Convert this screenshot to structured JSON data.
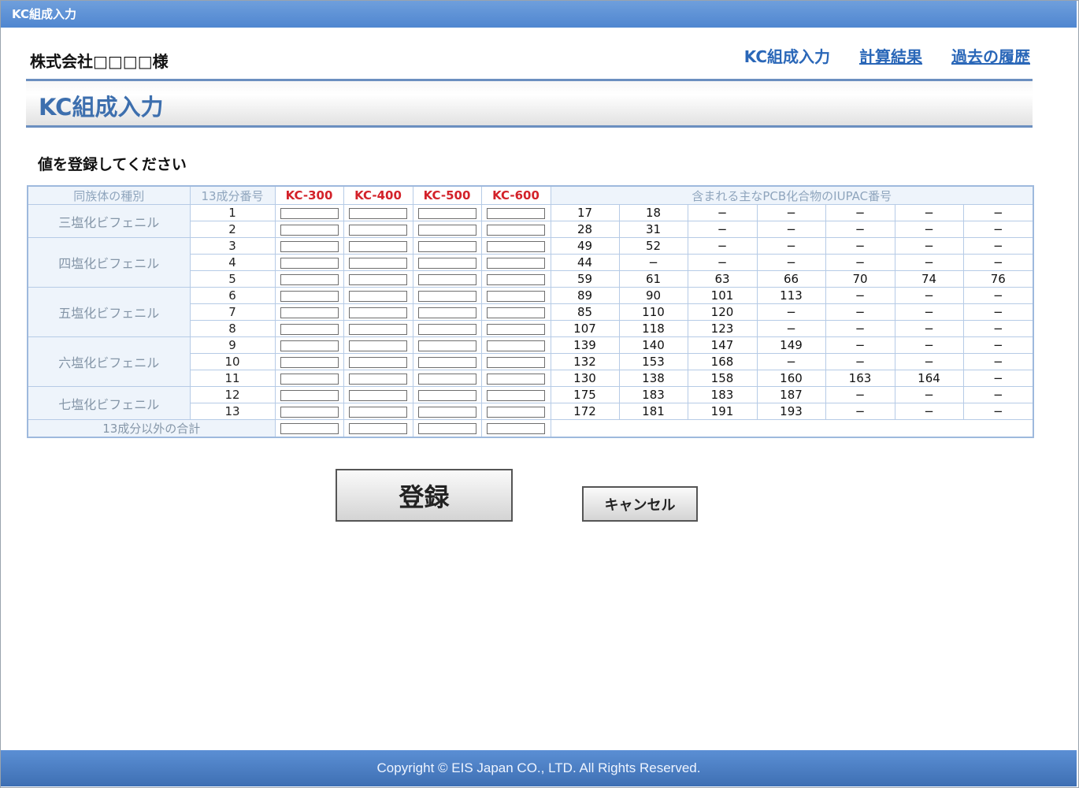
{
  "window": {
    "title": "KC組成入力"
  },
  "header": {
    "company": "株式会社□□□□様",
    "nav": [
      {
        "label": "KC組成入力",
        "link": false
      },
      {
        "label": "計算結果",
        "link": true
      },
      {
        "label": "過去の履歴",
        "link": true
      }
    ]
  },
  "page": {
    "heading": "KC組成入力",
    "instruction": "値を登録してください"
  },
  "table": {
    "headers": {
      "group": "同族体の種別",
      "number": "13成分番号",
      "kc": [
        "KC-300",
        "KC-400",
        "KC-500",
        "KC-600"
      ],
      "iupac": "含まれる主なPCB化合物のIUPAC番号"
    },
    "groups": [
      {
        "label": "三塩化ビフェニル",
        "rows": [
          {
            "num": "1",
            "iupac": [
              "17",
              "18",
              "−",
              "−",
              "−",
              "−",
              "−"
            ]
          },
          {
            "num": "2",
            "iupac": [
              "28",
              "31",
              "−",
              "−",
              "−",
              "−",
              "−"
            ]
          }
        ]
      },
      {
        "label": "四塩化ビフェニル",
        "rows": [
          {
            "num": "3",
            "iupac": [
              "49",
              "52",
              "−",
              "−",
              "−",
              "−",
              "−"
            ]
          },
          {
            "num": "4",
            "iupac": [
              "44",
              "−",
              "−",
              "−",
              "−",
              "−",
              "−"
            ]
          },
          {
            "num": "5",
            "iupac": [
              "59",
              "61",
              "63",
              "66",
              "70",
              "74",
              "76"
            ]
          }
        ]
      },
      {
        "label": "五塩化ビフェニル",
        "rows": [
          {
            "num": "6",
            "iupac": [
              "89",
              "90",
              "101",
              "113",
              "−",
              "−",
              "−"
            ]
          },
          {
            "num": "7",
            "iupac": [
              "85",
              "110",
              "120",
              "−",
              "−",
              "−",
              "−"
            ]
          },
          {
            "num": "8",
            "iupac": [
              "107",
              "118",
              "123",
              "−",
              "−",
              "−",
              "−"
            ]
          }
        ]
      },
      {
        "label": "六塩化ビフェニル",
        "rows": [
          {
            "num": "9",
            "iupac": [
              "139",
              "140",
              "147",
              "149",
              "−",
              "−",
              "−"
            ]
          },
          {
            "num": "10",
            "iupac": [
              "132",
              "153",
              "168",
              "−",
              "−",
              "−",
              "−"
            ]
          },
          {
            "num": "11",
            "iupac": [
              "130",
              "138",
              "158",
              "160",
              "163",
              "164",
              "−"
            ]
          }
        ]
      },
      {
        "label": "七塩化ビフェニル",
        "rows": [
          {
            "num": "12",
            "iupac": [
              "175",
              "183",
              "183",
              "187",
              "−",
              "−",
              "−"
            ]
          },
          {
            "num": "13",
            "iupac": [
              "172",
              "181",
              "191",
              "193",
              "−",
              "−",
              "−"
            ]
          }
        ]
      }
    ],
    "total_label": "13成分以外の合計"
  },
  "buttons": {
    "register": "登録",
    "cancel": "キャンセル"
  },
  "footer": {
    "copyright": "Copyright © EIS Japan CO., LTD. All Rights Reserved."
  }
}
